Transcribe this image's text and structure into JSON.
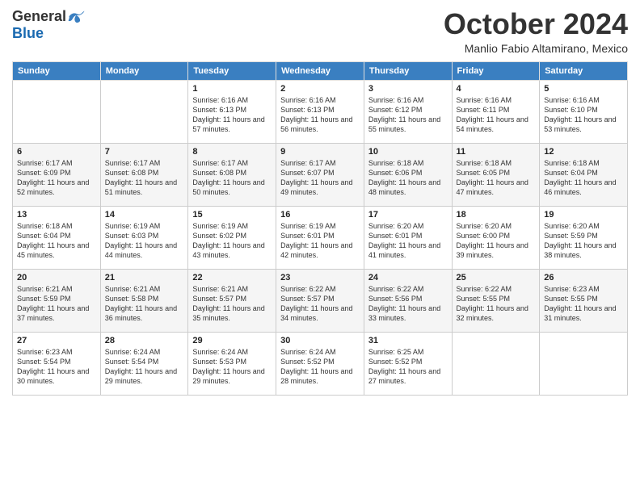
{
  "header": {
    "logo_general": "General",
    "logo_blue": "Blue",
    "month": "October 2024",
    "location": "Manlio Fabio Altamirano, Mexico"
  },
  "weekdays": [
    "Sunday",
    "Monday",
    "Tuesday",
    "Wednesday",
    "Thursday",
    "Friday",
    "Saturday"
  ],
  "weeks": [
    [
      {
        "day": "",
        "info": ""
      },
      {
        "day": "",
        "info": ""
      },
      {
        "day": "1",
        "info": "Sunrise: 6:16 AM\nSunset: 6:13 PM\nDaylight: 11 hours and 57 minutes."
      },
      {
        "day": "2",
        "info": "Sunrise: 6:16 AM\nSunset: 6:13 PM\nDaylight: 11 hours and 56 minutes."
      },
      {
        "day": "3",
        "info": "Sunrise: 6:16 AM\nSunset: 6:12 PM\nDaylight: 11 hours and 55 minutes."
      },
      {
        "day": "4",
        "info": "Sunrise: 6:16 AM\nSunset: 6:11 PM\nDaylight: 11 hours and 54 minutes."
      },
      {
        "day": "5",
        "info": "Sunrise: 6:16 AM\nSunset: 6:10 PM\nDaylight: 11 hours and 53 minutes."
      }
    ],
    [
      {
        "day": "6",
        "info": "Sunrise: 6:17 AM\nSunset: 6:09 PM\nDaylight: 11 hours and 52 minutes."
      },
      {
        "day": "7",
        "info": "Sunrise: 6:17 AM\nSunset: 6:08 PM\nDaylight: 11 hours and 51 minutes."
      },
      {
        "day": "8",
        "info": "Sunrise: 6:17 AM\nSunset: 6:08 PM\nDaylight: 11 hours and 50 minutes."
      },
      {
        "day": "9",
        "info": "Sunrise: 6:17 AM\nSunset: 6:07 PM\nDaylight: 11 hours and 49 minutes."
      },
      {
        "day": "10",
        "info": "Sunrise: 6:18 AM\nSunset: 6:06 PM\nDaylight: 11 hours and 48 minutes."
      },
      {
        "day": "11",
        "info": "Sunrise: 6:18 AM\nSunset: 6:05 PM\nDaylight: 11 hours and 47 minutes."
      },
      {
        "day": "12",
        "info": "Sunrise: 6:18 AM\nSunset: 6:04 PM\nDaylight: 11 hours and 46 minutes."
      }
    ],
    [
      {
        "day": "13",
        "info": "Sunrise: 6:18 AM\nSunset: 6:04 PM\nDaylight: 11 hours and 45 minutes."
      },
      {
        "day": "14",
        "info": "Sunrise: 6:19 AM\nSunset: 6:03 PM\nDaylight: 11 hours and 44 minutes."
      },
      {
        "day": "15",
        "info": "Sunrise: 6:19 AM\nSunset: 6:02 PM\nDaylight: 11 hours and 43 minutes."
      },
      {
        "day": "16",
        "info": "Sunrise: 6:19 AM\nSunset: 6:01 PM\nDaylight: 11 hours and 42 minutes."
      },
      {
        "day": "17",
        "info": "Sunrise: 6:20 AM\nSunset: 6:01 PM\nDaylight: 11 hours and 41 minutes."
      },
      {
        "day": "18",
        "info": "Sunrise: 6:20 AM\nSunset: 6:00 PM\nDaylight: 11 hours and 39 minutes."
      },
      {
        "day": "19",
        "info": "Sunrise: 6:20 AM\nSunset: 5:59 PM\nDaylight: 11 hours and 38 minutes."
      }
    ],
    [
      {
        "day": "20",
        "info": "Sunrise: 6:21 AM\nSunset: 5:59 PM\nDaylight: 11 hours and 37 minutes."
      },
      {
        "day": "21",
        "info": "Sunrise: 6:21 AM\nSunset: 5:58 PM\nDaylight: 11 hours and 36 minutes."
      },
      {
        "day": "22",
        "info": "Sunrise: 6:21 AM\nSunset: 5:57 PM\nDaylight: 11 hours and 35 minutes."
      },
      {
        "day": "23",
        "info": "Sunrise: 6:22 AM\nSunset: 5:57 PM\nDaylight: 11 hours and 34 minutes."
      },
      {
        "day": "24",
        "info": "Sunrise: 6:22 AM\nSunset: 5:56 PM\nDaylight: 11 hours and 33 minutes."
      },
      {
        "day": "25",
        "info": "Sunrise: 6:22 AM\nSunset: 5:55 PM\nDaylight: 11 hours and 32 minutes."
      },
      {
        "day": "26",
        "info": "Sunrise: 6:23 AM\nSunset: 5:55 PM\nDaylight: 11 hours and 31 minutes."
      }
    ],
    [
      {
        "day": "27",
        "info": "Sunrise: 6:23 AM\nSunset: 5:54 PM\nDaylight: 11 hours and 30 minutes."
      },
      {
        "day": "28",
        "info": "Sunrise: 6:24 AM\nSunset: 5:54 PM\nDaylight: 11 hours and 29 minutes."
      },
      {
        "day": "29",
        "info": "Sunrise: 6:24 AM\nSunset: 5:53 PM\nDaylight: 11 hours and 29 minutes."
      },
      {
        "day": "30",
        "info": "Sunrise: 6:24 AM\nSunset: 5:52 PM\nDaylight: 11 hours and 28 minutes."
      },
      {
        "day": "31",
        "info": "Sunrise: 6:25 AM\nSunset: 5:52 PM\nDaylight: 11 hours and 27 minutes."
      },
      {
        "day": "",
        "info": ""
      },
      {
        "day": "",
        "info": ""
      }
    ]
  ]
}
